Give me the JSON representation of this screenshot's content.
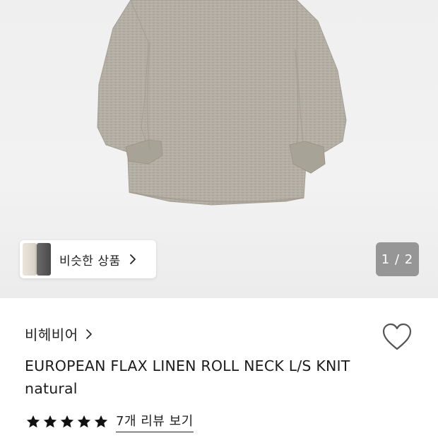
{
  "gallery": {
    "similar_label": "비슷한 상품",
    "pager_text": "1 / 2",
    "image_icon": "garment-photo"
  },
  "product": {
    "brand": "비헤비어",
    "title": "EUROPEAN FLAX LINEN ROLL NECK L/S KNIT natural",
    "rating": 5,
    "review_link": "7개 리뷰 보기"
  },
  "icons": {
    "chevron": "chevron-right-icon",
    "heart": "heart-icon",
    "star": "star-icon"
  },
  "colors": {
    "hero_bg": "#efefef",
    "garment": "#b3aea4",
    "text": "#1a1a1a",
    "pager_bg": "#7a7a7a"
  }
}
